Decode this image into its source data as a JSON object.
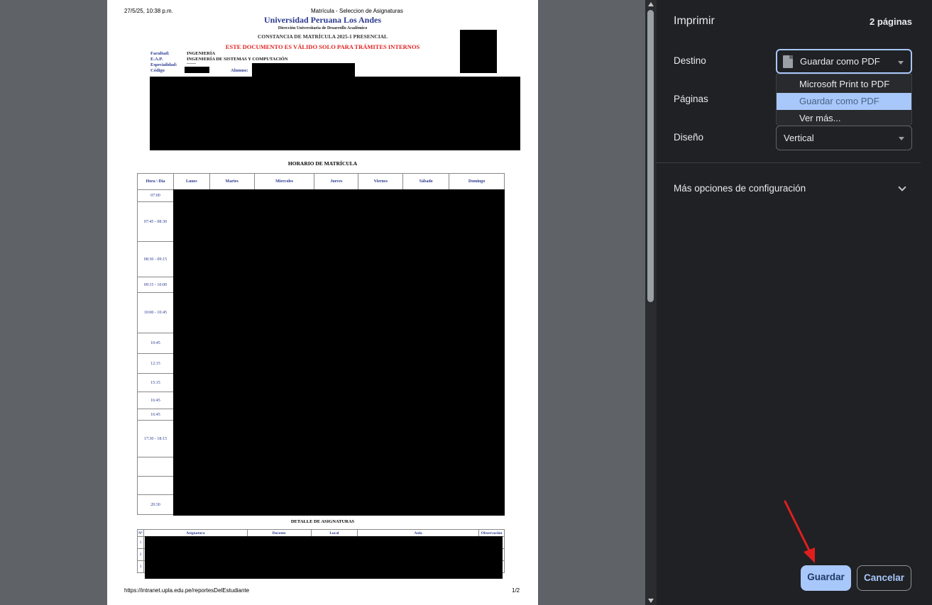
{
  "document": {
    "print_date": "27/5/25, 10:38 p.m.",
    "page_header_title": "Matrícula - Seleccion de Asignaturas",
    "university": "Universidad Peruana Los Andes",
    "direction": "Dirección Universitaria de Desarrollo Académico",
    "constancia": "CONSTANCIA DE MATRÍCULA 2025-1 PRESENCIAL",
    "warning": "ESTE DOCUMENTO ES VÁLIDO SOLO PARA TRÁMITES INTERNOS",
    "fields": {
      "facultad_label": "Facultad:",
      "facultad_value": "INGENIERÍA",
      "eap_label": "E.A.P.",
      "eap_value": "INGENIERÍA DE SISTEMAS Y COMPUTACIÓN",
      "especialidad_label": "Especialidad:",
      "especialidad_value": "------",
      "codigo_label": "Código",
      "alumno_label": "Alumno:"
    },
    "schedule_title": "HORARIO DE MATRÍCULA",
    "schedule_headers": [
      "Hora \\ Día",
      "Lunes",
      "Martes",
      "Miercoles",
      "Jueves",
      "Viernes",
      "Sábado",
      "Domingo"
    ],
    "schedule_times": [
      "07:00",
      "07:45 - 08:30",
      "08:30 - 09:15",
      "09:15 - 10:00",
      "10:00 - 10:45",
      "10:45",
      "12:15",
      "15:15",
      "16:45",
      "16:45",
      "17:30 - 18:15",
      "",
      "",
      "20:30"
    ],
    "detail_title": "DETALLE DE ASIGNATURAS",
    "detail_headers": [
      "Nº",
      "Asignatura",
      "Docente",
      "Local",
      "Aula",
      "Observación"
    ],
    "detail_rows": [
      "1",
      "2",
      "3"
    ],
    "footer_url": "https://intranet.upla.edu.pe/reportesDelEstudiante",
    "footer_page": "1/2"
  },
  "panel": {
    "title": "Imprimir",
    "page_count": "2 páginas",
    "destino_label": "Destino",
    "destino_value": "Guardar como PDF",
    "destino_options": [
      "Microsoft Print to PDF",
      "Guardar como PDF",
      "Ver más..."
    ],
    "paginas_label": "Páginas",
    "diseno_label": "Diseño",
    "diseno_value": "Vertical",
    "more_options": "Más opciones de configuración",
    "save_label": "Guardar",
    "cancel_label": "Cancelar"
  },
  "colors": {
    "accent": "#a8c7fa",
    "panel_bg": "#202124",
    "warning_red": "#e02020",
    "doc_blue": "#2b3a8f",
    "annotation_arrow": "#e01e1e"
  },
  "icons": [
    "document-icon",
    "caret-down-icon",
    "chevron-down-icon",
    "annotation-arrow"
  ]
}
